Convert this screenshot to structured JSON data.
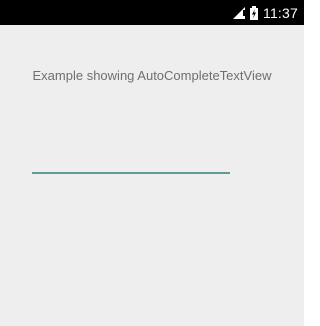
{
  "status_bar": {
    "time": "11:37",
    "signal_icon": "signal-icon",
    "battery_icon": "battery-charging-icon",
    "accent": "#ffffff"
  },
  "main": {
    "heading": "Example showing AutoCompleteTextView",
    "input": {
      "value": "",
      "placeholder": "",
      "underline_color": "#5e9e92"
    }
  },
  "colors": {
    "background": "#eeeeee",
    "status_bar": "#000000",
    "heading_text": "#6f6f6f"
  }
}
